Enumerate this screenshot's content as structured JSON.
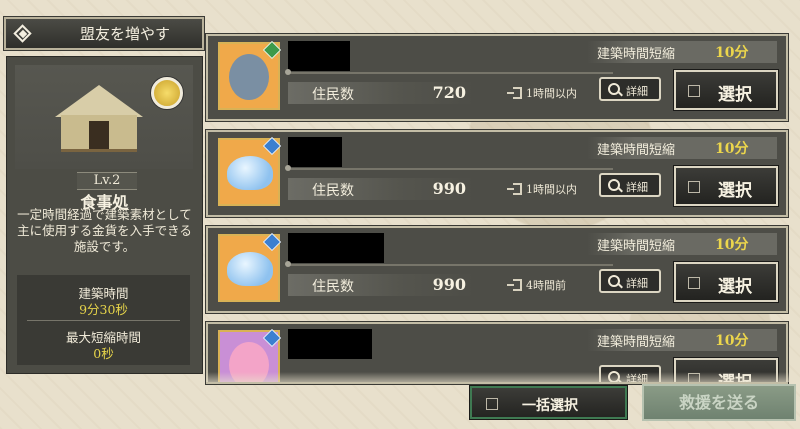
{
  "header": {
    "title": "盟友を増やす"
  },
  "facility": {
    "level": "Lv.2",
    "name": "食事処",
    "description": "一定時間経過で建築素材として主に使用する金貨を入手できる施設です。",
    "build_time_label": "建築時間",
    "build_time_value": "9分30秒",
    "max_short_label": "最大短縮時間",
    "max_short_value": "0秒"
  },
  "labels": {
    "residents": "住民数",
    "short_label": "建築時間短縮",
    "detail": "詳細",
    "select": "選択",
    "bulk_select": "一括選択",
    "send": "救援を送る"
  },
  "allies": [
    {
      "residents": "720",
      "short_value": "10分",
      "login": "1時間以内",
      "attribute_color": "#3d9a4a",
      "avatar": "wolf-avatar"
    },
    {
      "residents": "990",
      "short_value": "10分",
      "login": "1時間以内",
      "attribute_color": "#3c7fd0",
      "avatar": "slime-avatar"
    },
    {
      "residents": "990",
      "short_value": "10分",
      "login": "4時間前",
      "attribute_color": "#3c7fd0",
      "avatar": "slime-avatar"
    },
    {
      "residents": "",
      "short_value": "10分",
      "login": "",
      "attribute_color": "#3c7fd0",
      "avatar": "pink-hair-avatar"
    }
  ]
}
